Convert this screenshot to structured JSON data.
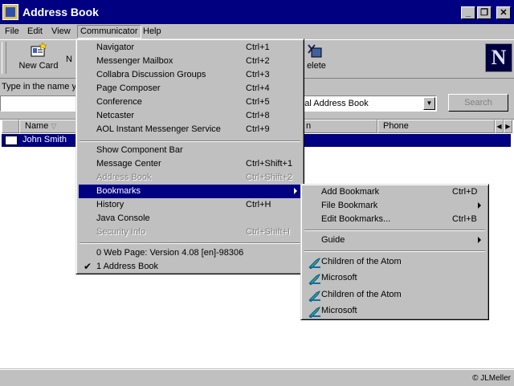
{
  "window": {
    "title": "Address Book",
    "min": "_",
    "max": "❐",
    "close": "✕"
  },
  "menubar": [
    "File",
    "Edit",
    "View",
    "Communicator",
    "Help"
  ],
  "toolbar": {
    "new_card": "New Card",
    "new_list_partial": "N",
    "delete_partial": "elete"
  },
  "search": {
    "label_partial": "Type in the name yo",
    "directory_partial": "onal Address Book",
    "button": "Search"
  },
  "columns": {
    "name": "Name",
    "sort_glyph": "▽",
    "middle_partial": "n",
    "phone": "Phone"
  },
  "rows": [
    {
      "name": "John Smith"
    }
  ],
  "status": "© JLMeller",
  "communicator_menu": {
    "group1": [
      {
        "label": "Navigator",
        "shortcut": "Ctrl+1"
      },
      {
        "label": "Messenger Mailbox",
        "shortcut": "Ctrl+2"
      },
      {
        "label": "Collabra Discussion Groups",
        "shortcut": "Ctrl+3"
      },
      {
        "label": "Page Composer",
        "shortcut": "Ctrl+4"
      },
      {
        "label": "Conference",
        "shortcut": "Ctrl+5"
      },
      {
        "label": "Netcaster",
        "shortcut": "Ctrl+8"
      },
      {
        "label": "AOL Instant Messenger Service",
        "shortcut": "Ctrl+9"
      }
    ],
    "group2": [
      {
        "label": "Show Component Bar",
        "shortcut": ""
      },
      {
        "label": "Message Center",
        "shortcut": "Ctrl+Shift+1"
      },
      {
        "label": "Address Book",
        "shortcut": "Ctrl+Shift+2"
      },
      {
        "label": "Bookmarks",
        "shortcut": ""
      },
      {
        "label": "History",
        "shortcut": "Ctrl+H"
      },
      {
        "label": "Java Console",
        "shortcut": ""
      },
      {
        "label": "Security Info",
        "shortcut": "Ctrl+Shift+I"
      }
    ],
    "group3": [
      {
        "label": "0 Web Page: Version 4.08 [en]-98306"
      },
      {
        "label": "1 Address Book"
      }
    ]
  },
  "bookmarks_menu": {
    "add": {
      "label": "Add Bookmark",
      "shortcut": "Ctrl+D"
    },
    "file": {
      "label": "File Bookmark"
    },
    "edit": {
      "label": "Edit Bookmarks...",
      "shortcut": "Ctrl+B"
    },
    "guide": {
      "label": "Guide"
    },
    "items": [
      "Children of the Atom",
      "Microsoft",
      "Children of the Atom",
      "Microsoft"
    ]
  }
}
